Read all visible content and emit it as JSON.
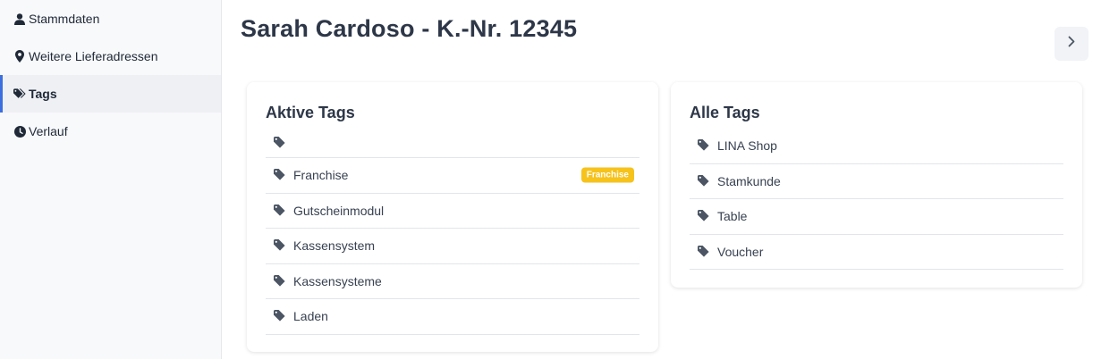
{
  "sidebar": {
    "items": [
      {
        "label": "Stammdaten",
        "icon": "user-icon"
      },
      {
        "label": "Weitere Lieferadressen",
        "icon": "map-marker-icon"
      },
      {
        "label": "Tags",
        "icon": "tags-icon",
        "active": true
      },
      {
        "label": "Verlauf",
        "icon": "clock-icon"
      }
    ]
  },
  "header": {
    "title": "Sarah Cardoso - K.-Nr. 12345",
    "next_icon": "chevron-right-icon"
  },
  "aktive_tags": {
    "title": "Aktive Tags",
    "items": [
      {
        "label": ""
      },
      {
        "label": "Franchise",
        "badge": "Franchise"
      },
      {
        "label": "Gutscheinmodul"
      },
      {
        "label": "Kassensystem"
      },
      {
        "label": "Kassensysteme"
      },
      {
        "label": "Laden"
      }
    ]
  },
  "alle_tags": {
    "title": "Alle Tags",
    "items": [
      {
        "label": "LINA Shop"
      },
      {
        "label": "Stamkunde"
      },
      {
        "label": "Table"
      },
      {
        "label": "Voucher"
      }
    ]
  },
  "colors": {
    "accent": "#3b6fe0",
    "badge": "#f6c21c",
    "icon": "#4b5563"
  }
}
